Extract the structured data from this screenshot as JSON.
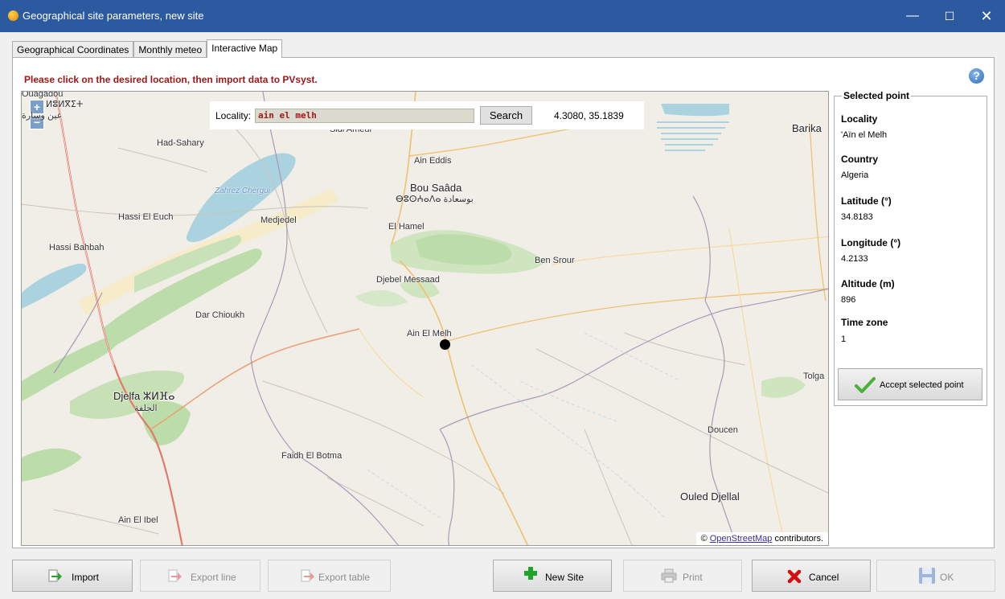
{
  "window": {
    "title": "Geographical site parameters, new site",
    "minimize": "—",
    "maximize": "☐",
    "close": "✕"
  },
  "tabs": [
    {
      "label": "Geographical Coordinates"
    },
    {
      "label": "Monthly meteo"
    },
    {
      "label": "Interactive Map",
      "active": true
    }
  ],
  "instruction": "Please click on the desired location, then import data to PVsyst.",
  "help": "?",
  "search": {
    "label": "Locality:",
    "value": "ain el melh",
    "button": "Search",
    "coords": "4.3080, 35.1839"
  },
  "map": {
    "zoom_in": "+",
    "zoom_out": "−",
    "attribution_prefix": "©",
    "attribution_link": "OpenStreetMap",
    "attribution_suffix": "contributors.",
    "labels": [
      "Ouagadou",
      "ⵍⵓⵍⴳⵉⵜ",
      "عين وسارة",
      "Sidi Ameur",
      "Barika",
      "Had-Sahary",
      "Ain Eddis",
      "Bou Saâda",
      "ⴱⵓⵙⵄⴰⴷⴰ بوسعادة",
      "Zahrez Chergui",
      "Hassi El Euch",
      "Medjedel",
      "El Hamel",
      "Hassi Bahbah",
      "Ben Srour",
      "Djebel Messaad",
      "Dar Chioukh",
      "Ain El Melh",
      "Tolga",
      "Djelfa ⵣⵍⴼⴰ",
      "الجلفة",
      "Doucen",
      "Faidh El Botma",
      "Ouled Djellal",
      "Ain El Ibel"
    ]
  },
  "selected_point": {
    "legend": "Selected point",
    "fields": [
      {
        "label": "Locality",
        "value": "'Aïn el Melh"
      },
      {
        "label": "Country",
        "value": "Algeria"
      },
      {
        "label": "Latitude (°)",
        "value": "34.8183"
      },
      {
        "label": "Longitude (°)",
        "value": "4.2133"
      },
      {
        "label": "Altitude (m)",
        "value": "896"
      },
      {
        "label": "Time zone",
        "value": "1"
      }
    ],
    "accept": "Accept selected point"
  },
  "buttons": {
    "import": "Import",
    "export_line": "Export line",
    "export_table": "Export table",
    "new_site": "New Site",
    "print": "Print",
    "cancel": "Cancel",
    "ok": "OK"
  }
}
